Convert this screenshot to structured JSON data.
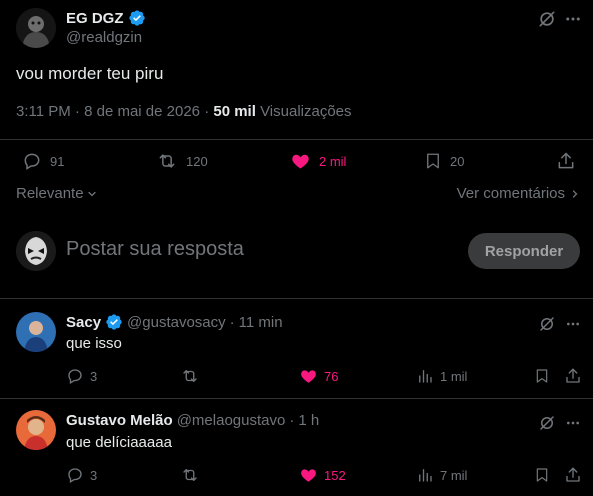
{
  "main_tweet": {
    "author_name": "EG DGZ",
    "author_handle": "@realdgzin",
    "text": "vou morder teu piru",
    "time": "3:11 PM",
    "date": "8 de mai de 2026",
    "views_count": "50 mil",
    "views_label": "Visualizações",
    "replies": "91",
    "reposts": "120",
    "likes": "2 mil",
    "bookmarks": "20",
    "liked": true
  },
  "sort": {
    "label": "Relevante"
  },
  "view_replies": {
    "label": "Ver comentários"
  },
  "compose": {
    "placeholder": "Postar sua resposta",
    "button_label": "Responder"
  },
  "replies": [
    {
      "name": "Sacy",
      "verified": true,
      "handle": "@gustavosacy",
      "time": "11 min",
      "text": "que isso",
      "replies": "3",
      "reposts": "",
      "likes": "76",
      "views": "1 mil"
    },
    {
      "name": "Gustavo Melão",
      "verified": false,
      "handle": "@melaogustavo",
      "time": "1 h",
      "text": "que delíciaaaaa",
      "replies": "3",
      "reposts": "",
      "likes": "152",
      "views": "7 mil"
    }
  ],
  "colors": {
    "background": "#000000",
    "text": "#e7e9ea",
    "muted": "#71767b",
    "like_pink": "#f91880",
    "verified_blue": "#1d9bf0",
    "divider": "#2f3336",
    "reply_button_bg": "#3a3b3c"
  }
}
